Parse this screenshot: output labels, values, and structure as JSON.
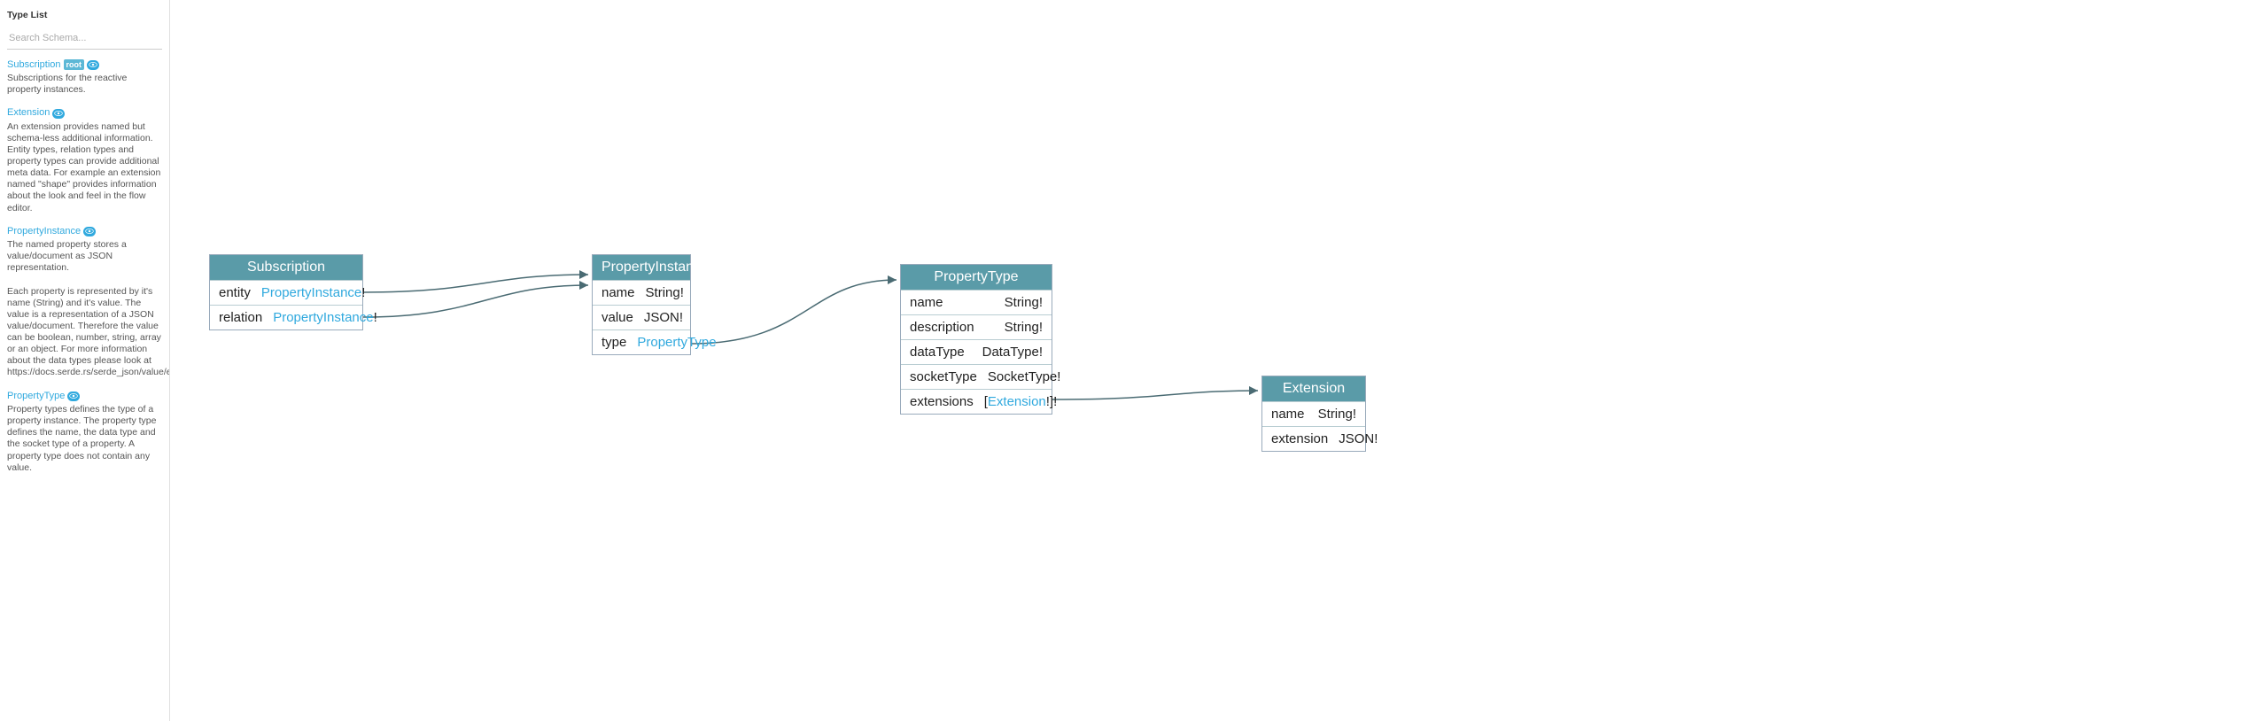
{
  "sidebar": {
    "title": "Type List",
    "search_placeholder": "Search Schema...",
    "types": [
      {
        "name": "Subscription",
        "root": true,
        "description": "Subscriptions for the reactive property instances."
      },
      {
        "name": "Extension",
        "root": false,
        "description": "An extension provides named but schema-less additional information. Entity types, relation types and property types can provide additional meta data. For example an extension named \"shape\" provides information about the look and feel in the flow editor."
      },
      {
        "name": "PropertyInstance",
        "root": false,
        "description": "The named property stores a value/document as JSON representation.\n\nEach property is represented by it's name (String) and it's value. The value is a representation of a JSON value/document. Therefore the value can be boolean, number, string, array or an object. For more information about the data types please look at https://docs.serde.rs/serde_json/value/enum.Value.html"
      },
      {
        "name": "PropertyType",
        "root": false,
        "description": "Property types defines the type of a property instance. The property type defines the name, the data type and the socket type of a property. A property type does not contain any value."
      }
    ]
  },
  "nodes": {
    "subscription": {
      "title": "Subscription",
      "fields": [
        {
          "name": "entity",
          "type_prefix": "",
          "type_ref": "PropertyInstance",
          "type_suffix": "!"
        },
        {
          "name": "relation",
          "type_prefix": "",
          "type_ref": "PropertyInstance",
          "type_suffix": "!"
        }
      ]
    },
    "propertyInstance": {
      "title": "PropertyInstance",
      "fields": [
        {
          "name": "name",
          "type_prefix": "String!",
          "type_ref": "",
          "type_suffix": ""
        },
        {
          "name": "value",
          "type_prefix": "JSON!",
          "type_ref": "",
          "type_suffix": ""
        },
        {
          "name": "type",
          "type_prefix": "",
          "type_ref": "PropertyType",
          "type_suffix": ""
        }
      ]
    },
    "propertyType": {
      "title": "PropertyType",
      "fields": [
        {
          "name": "name",
          "type_prefix": "String!",
          "type_ref": "",
          "type_suffix": ""
        },
        {
          "name": "description",
          "type_prefix": "String!",
          "type_ref": "",
          "type_suffix": ""
        },
        {
          "name": "dataType",
          "type_prefix": "DataType!",
          "type_ref": "",
          "type_suffix": ""
        },
        {
          "name": "socketType",
          "type_prefix": "SocketType!",
          "type_ref": "",
          "type_suffix": ""
        },
        {
          "name": "extensions",
          "type_prefix": "[",
          "type_ref": "Extension",
          "type_suffix": "!]!"
        }
      ]
    },
    "extension": {
      "title": "Extension",
      "fields": [
        {
          "name": "name",
          "type_prefix": "String!",
          "type_ref": "",
          "type_suffix": ""
        },
        {
          "name": "extension",
          "type_prefix": "JSON!",
          "type_ref": "",
          "type_suffix": ""
        }
      ]
    }
  }
}
